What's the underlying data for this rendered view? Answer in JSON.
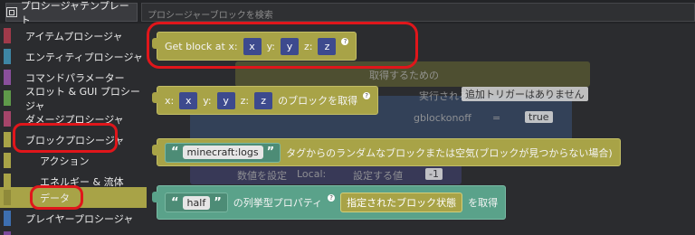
{
  "header": {
    "title_tab": "プロシージャテンプレート",
    "search_placeholder": "プロシージャーブロックを検索"
  },
  "sidebar": {
    "items": [
      {
        "label": "アイテムプロシージャ",
        "color": "#a03a4a"
      },
      {
        "label": "エンティティプロシージャ",
        "color": "#3e86a4"
      },
      {
        "label": "コマンドパラメーター",
        "color": "#8a4f9c"
      },
      {
        "label": "スロット & GUI プロシージャ",
        "color": "#5f9a4a"
      },
      {
        "label": "ダメージプロシージャ",
        "color": "#a5456a"
      },
      {
        "label": "ブロックプロシージャ",
        "color": "#a8a347"
      },
      {
        "label": "アクション",
        "color": "#a8a347"
      },
      {
        "label": "エネルギー & 流体",
        "color": "#a8a347"
      },
      {
        "label": "データ",
        "color": "#a8a347"
      },
      {
        "label": "プレイヤープロシージャ",
        "color": "#3d6fb0"
      }
    ]
  },
  "workspace": {
    "block1": {
      "text": "Get block at x:",
      "x_slot": "x",
      "y_label": "y:",
      "y_slot": "y",
      "z_label": "z:",
      "z_slot": "z"
    },
    "block2": {
      "x_label": "x:",
      "x_slot": "x",
      "y_label": "y:",
      "y_slot": "y",
      "z_label": "z:",
      "z_slot": "z",
      "suffix": "のブロックを取得"
    },
    "block3": {
      "open_quote": "“",
      "value": "minecraft:logs",
      "close_quote": "”",
      "suffix": "タグからのランダムなブロックまたは空気(ブロックが見つからない場合)"
    },
    "block4": {
      "open_quote": "“",
      "value": "half",
      "close_quote": "”",
      "middle": "の列挙型プロパティ",
      "inner": "指定されたブロック状態",
      "suffix": "を取得"
    },
    "background": {
      "trigger": "追加トリガーはありません",
      "executed": "実行される",
      "gblock": "gblockonoff",
      "equals": "=",
      "true_val": "true",
      "set_number": "数値を設定",
      "local": "Local:",
      "set_value": "設定する値",
      "minus_one": "-1",
      "partial": "取得するための"
    }
  },
  "colors": {
    "highlight": "#e0161b",
    "block_olive": "#a8a347",
    "block_teal": "#5aa28a",
    "slot_blue": "#3d4a8e"
  }
}
